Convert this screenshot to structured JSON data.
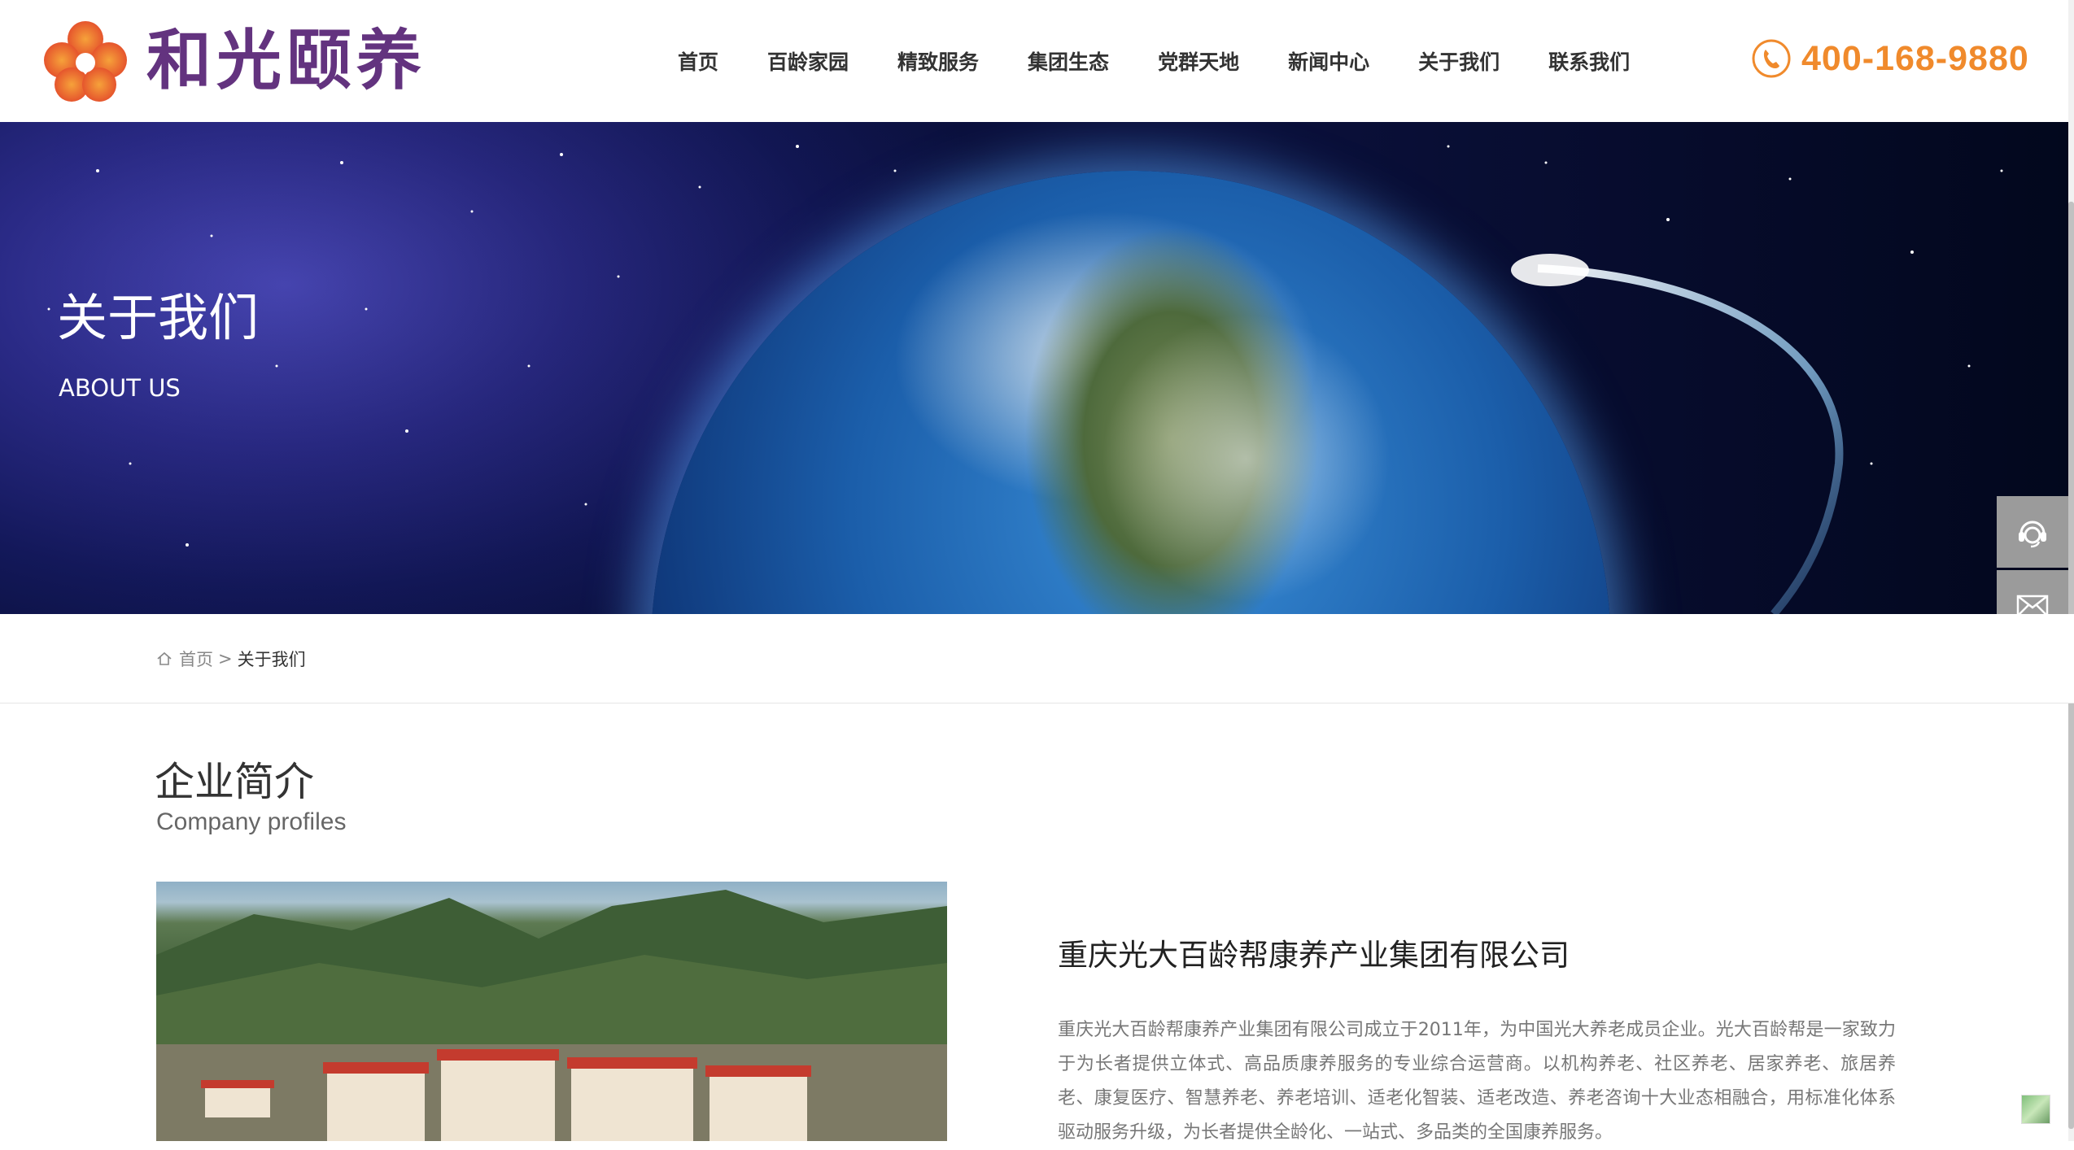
{
  "header": {
    "logo_text": "和光颐养",
    "nav": [
      "首页",
      "百龄家园",
      "精致服务",
      "集团生态",
      "党群天地",
      "新闻中心",
      "关于我们",
      "联系我们"
    ],
    "hotline": "400-168-9880",
    "phone_icon": "phone-icon"
  },
  "banner": {
    "title": "关于我们",
    "subtitle": "ABOUT US"
  },
  "side_tools": {
    "items": [
      "customer-service-icon",
      "mail-icon"
    ]
  },
  "breadcrumb": {
    "home": "首页",
    "separator": ">",
    "current": "关于我们"
  },
  "about": {
    "section_title": "企业简介",
    "section_subtitle": "Company profiles",
    "company_name": "重庆光大百龄帮康养产业集团有限公司",
    "description": "重庆光大百龄帮康养产业集团有限公司成立于2011年，为中国光大养老成员企业。光大百龄帮是一家致力于为长者提供立体式、高品质康养服务的专业综合运营商。以机构养老、社区养老、居家养老、旅居养老、康复医疗、智慧养老、养老培训、适老化智装、适老改造、养老咨询十大业态相融合，用标准化体系驱动服务升级，为长者提供全龄化、一站式、多品类的全国康养服务。"
  },
  "colors": {
    "brand_purple": "#63337f",
    "hotline_orange": "#f08a2c",
    "side_tool_gray": "#9b9b9b"
  }
}
